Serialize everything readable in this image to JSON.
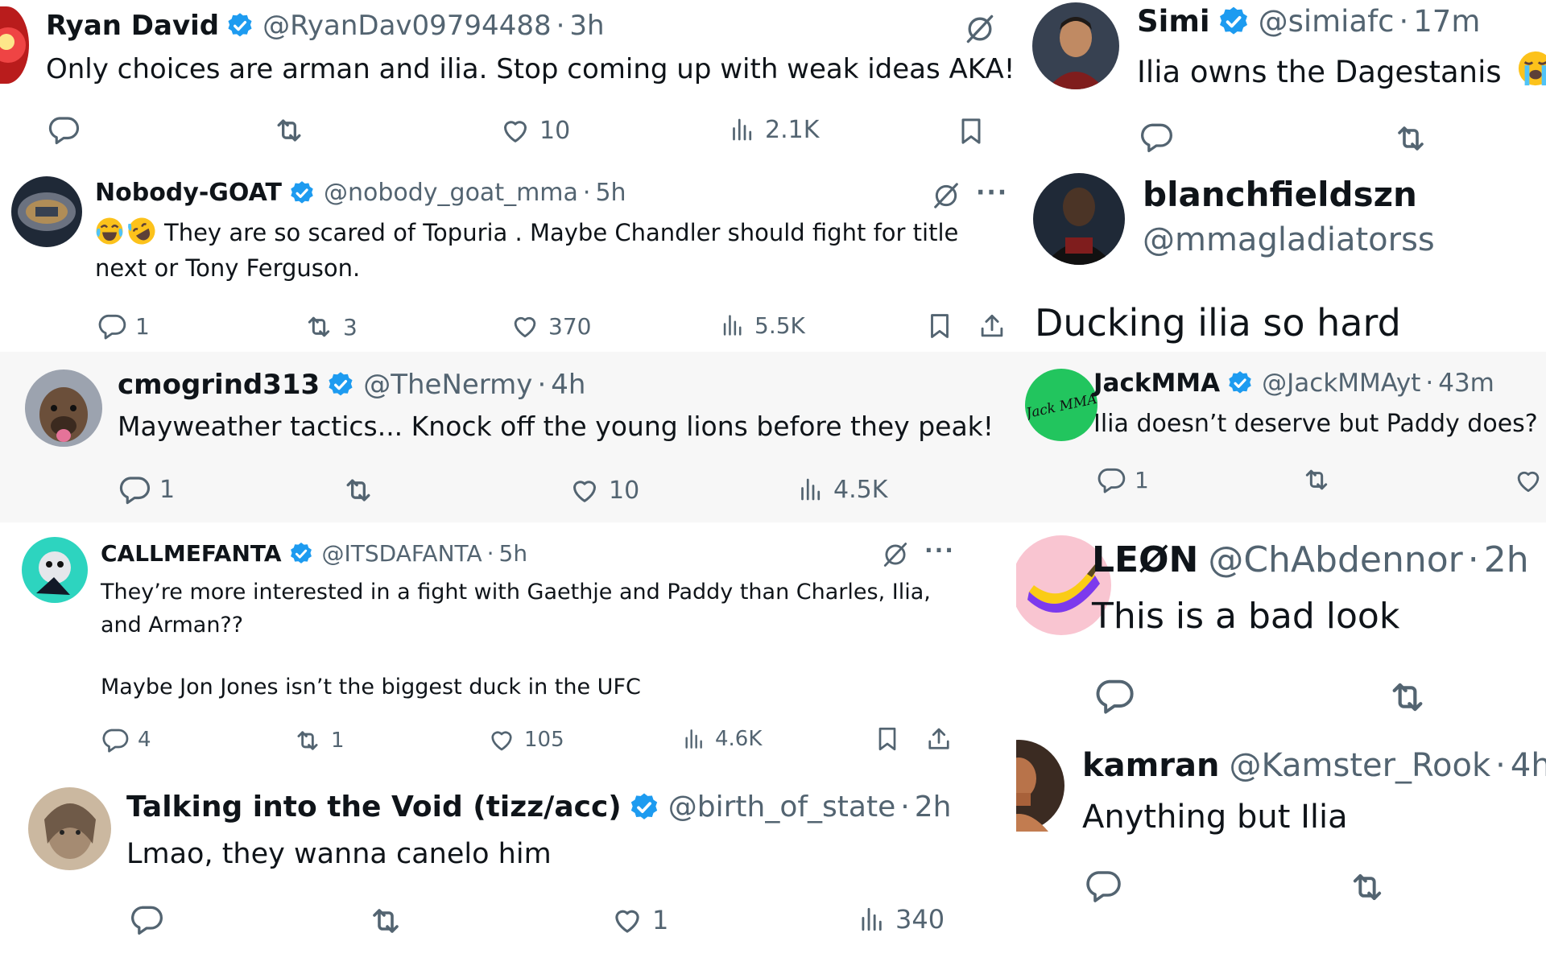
{
  "left": [
    {
      "name": "Ryan David",
      "handle": "@RyanDav09794488",
      "time": "3h",
      "text": "Only choices are arman and ilia. Stop coming up with weak ideas AKA!!!!",
      "likes": "10",
      "views": "2.1K"
    },
    {
      "name": "Nobody-GOAT",
      "handle": "@nobody_goat_mma",
      "time": "5h",
      "text": "They are so scared of Topuria .   Maybe Chandler should fight for title next or Tony Ferguson.",
      "emoji": [
        "face-with-tears-of-joy",
        "rolling-on-the-floor-laughing"
      ],
      "replies": "1",
      "reposts": "3",
      "likes": "370",
      "views": "5.5K",
      "more": "···"
    },
    {
      "name": "cmogrind313",
      "handle": "@TheNermy",
      "time": "4h",
      "text": "Mayweather tactics... Knock off the young lions before they peak!",
      "replies": "1",
      "likes": "10",
      "views": "4.5K"
    },
    {
      "name": "CALLMEFANTA",
      "handle": "@ITSDAFANTA",
      "time": "5h",
      "text1": "They’re more interested in a fight with Gaethje and Paddy than Charles, Ilia, and Arman??",
      "text2": "Maybe Jon Jones isn’t the biggest duck in the UFC",
      "replies": "4",
      "reposts": "1",
      "likes": "105",
      "views": "4.6K",
      "more": "···"
    },
    {
      "name": "Talking into the Void (tizz/acc)",
      "handle": "@birth_of_state",
      "time": "2h",
      "text": "Lmao, they wanna canelo him",
      "likes": "1",
      "views": "340"
    }
  ],
  "right": [
    {
      "name": "Simi",
      "handle": "@simiafc",
      "time": "17m",
      "text": "Ilia owns the Dagestanis",
      "emoji": [
        "loudly-crying-face"
      ]
    },
    {
      "name": "blanchfieldszn",
      "handle": "@mmagladiatorss",
      "text": "Ducking ilia so hard"
    },
    {
      "name": "JackMMA",
      "handle": "@JackMMAyt",
      "time": "43m",
      "text": "Ilia doesn’t deserve but Paddy does?",
      "replies": "1",
      "avatar_text": "Jack MMA"
    },
    {
      "name": "LEØN",
      "handle": "@ChAbdennor",
      "time": "2h",
      "text": "This is a bad look"
    },
    {
      "name": "kamran",
      "handle": "@Kamster_Rook",
      "time": "4h",
      "text": "Anything but Ilia"
    }
  ],
  "separator": "·",
  "colors": {
    "text": "#0f1419",
    "secondary": "#536471",
    "verified": "#1d9bf0",
    "gray_panel": "#f7f7f7"
  },
  "icons": [
    "reply-icon",
    "repost-icon",
    "like-icon",
    "views-icon",
    "bookmark-icon",
    "share-icon",
    "grok-slash-icon",
    "more-icon",
    "verified-badge-icon"
  ]
}
